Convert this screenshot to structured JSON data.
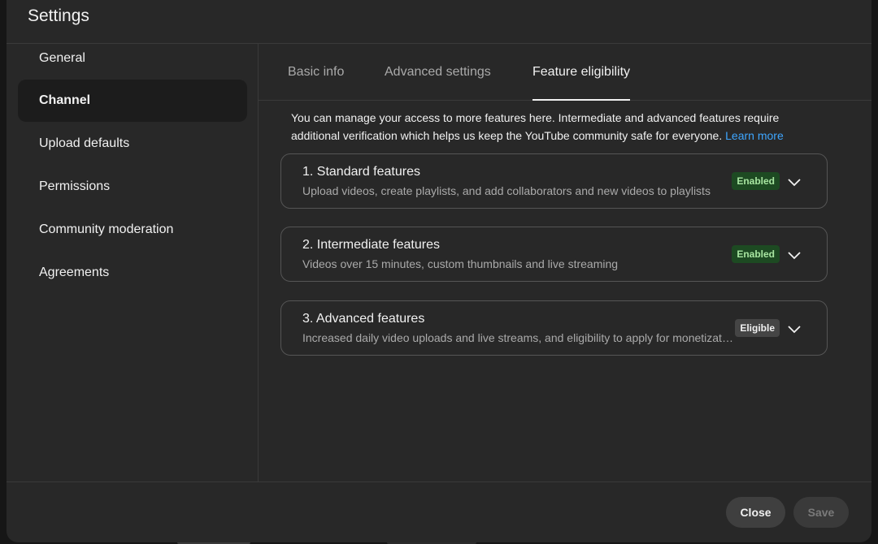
{
  "dialog": {
    "title": "Settings"
  },
  "sidebar": {
    "items": [
      {
        "label": "General"
      },
      {
        "label": "Channel"
      },
      {
        "label": "Upload defaults"
      },
      {
        "label": "Permissions"
      },
      {
        "label": "Community moderation"
      },
      {
        "label": "Agreements"
      }
    ],
    "active": "Channel"
  },
  "tabs": [
    {
      "label": "Basic info"
    },
    {
      "label": "Advanced settings"
    },
    {
      "label": "Feature eligibility"
    }
  ],
  "intro": {
    "text": "You can manage your access to more features here. Intermediate and advanced features require additional verification which helps us keep the YouTube community safe for everyone.",
    "link_label": "Learn more"
  },
  "features": [
    {
      "title": "1. Standard features",
      "description": "Upload videos, create playlists, and add collaborators and new videos to playlists",
      "status": "Enabled"
    },
    {
      "title": "2. Intermediate features",
      "description": "Videos over 15 minutes, custom thumbnails and live streaming",
      "status": "Enabled"
    },
    {
      "title": "3. Advanced features",
      "description": "Increased daily video uploads and live streams, and eligibility to apply for monetization",
      "status": "Eligible"
    }
  ],
  "footer": {
    "close_label": "Close",
    "save_label": "Save"
  },
  "colors": {
    "dialog_bg": "#282828",
    "enabled_badge_bg": "#1d4a22",
    "enabled_badge_text": "#a8e6a1",
    "link": "#3ea6ff"
  },
  "icons": {
    "card_expand": "chevron-down-icon"
  }
}
